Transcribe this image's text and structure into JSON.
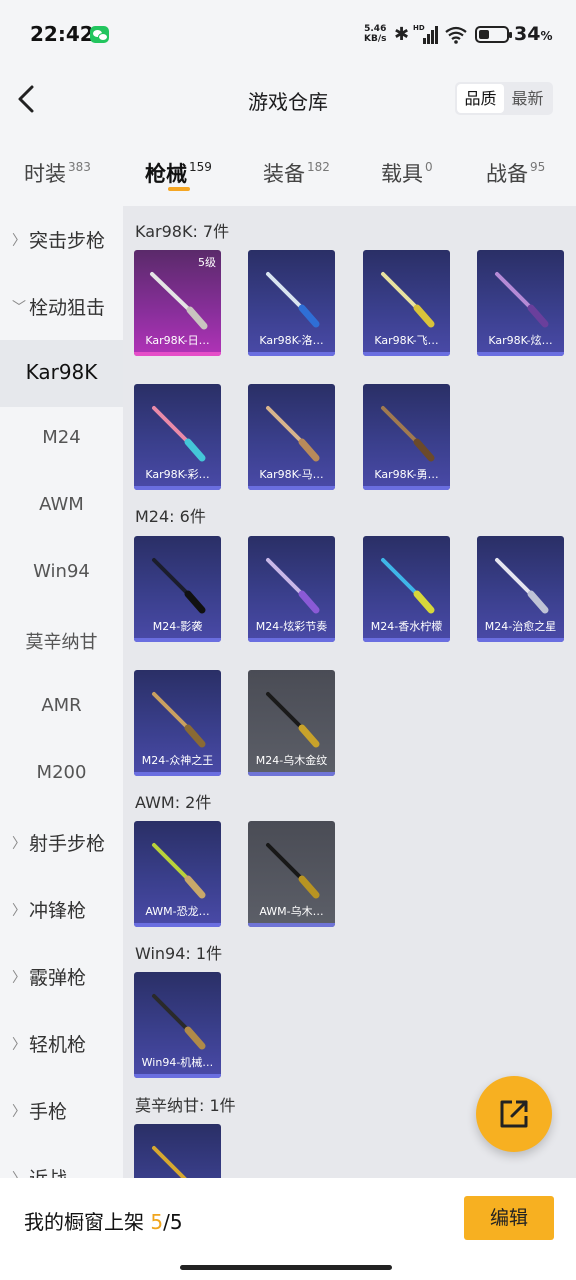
{
  "status_bar": {
    "time": "22:42",
    "net_speed_value": "5.46",
    "net_speed_unit": "KB/s",
    "hd_label": "HD",
    "battery_percent": "34",
    "battery_unit": "%"
  },
  "header": {
    "title": "游戏仓库",
    "sort_options": [
      "品质",
      "最新"
    ]
  },
  "tabs": [
    {
      "label": "时装",
      "count": "383"
    },
    {
      "label": "枪械",
      "count": "159"
    },
    {
      "label": "装备",
      "count": "182"
    },
    {
      "label": "载具",
      "count": "0"
    },
    {
      "label": "战备",
      "count": "95"
    }
  ],
  "sidebar": {
    "items": [
      {
        "label": "突击步枪"
      },
      {
        "label": "栓动狙击"
      },
      {
        "label": "Kar98K"
      },
      {
        "label": "M24"
      },
      {
        "label": "AWM"
      },
      {
        "label": "Win94"
      },
      {
        "label": "莫辛纳甘"
      },
      {
        "label": "AMR"
      },
      {
        "label": "M200"
      },
      {
        "label": "射手步枪"
      },
      {
        "label": "冲锋枪"
      },
      {
        "label": "霰弹枪"
      },
      {
        "label": "轻机枪"
      },
      {
        "label": "手枪"
      },
      {
        "label": "近战"
      }
    ]
  },
  "sections": {
    "kar98k": {
      "title": "Kar98K: 7件",
      "items": [
        {
          "name": "Kar98K-日…",
          "level": "5级"
        },
        {
          "name": "Kar98K-洛…"
        },
        {
          "name": "Kar98K-飞…"
        },
        {
          "name": "Kar98K-炫…"
        },
        {
          "name": "Kar98K-彩…"
        },
        {
          "name": "Kar98K-马…"
        },
        {
          "name": "Kar98K-勇…"
        }
      ]
    },
    "m24": {
      "title": "M24: 6件",
      "items": [
        {
          "name": "M24-影袭"
        },
        {
          "name": "M24-炫彩节奏"
        },
        {
          "name": "M24-香水柠檬"
        },
        {
          "name": "M24-治愈之星"
        },
        {
          "name": "M24-众神之王"
        },
        {
          "name": "M24-乌木金纹"
        }
      ]
    },
    "awm": {
      "title": "AWM: 2件",
      "items": [
        {
          "name": "AWM-恐龙…"
        },
        {
          "name": "AWM-乌木…"
        }
      ]
    },
    "win94": {
      "title": "Win94: 1件",
      "items": [
        {
          "name": "Win94-机械…"
        }
      ]
    },
    "mosin": {
      "title": "莫辛纳甘: 1件"
    }
  },
  "bottom_bar": {
    "showcase_label": "我的橱窗上架",
    "showcase_current": "5",
    "showcase_total": "/5",
    "edit_label": "编辑"
  },
  "colors": {
    "accent": "#f7b021",
    "card_blue": "#3a3f8c",
    "card_pink": "#b233b8",
    "card_gray": "#5c5f68"
  }
}
